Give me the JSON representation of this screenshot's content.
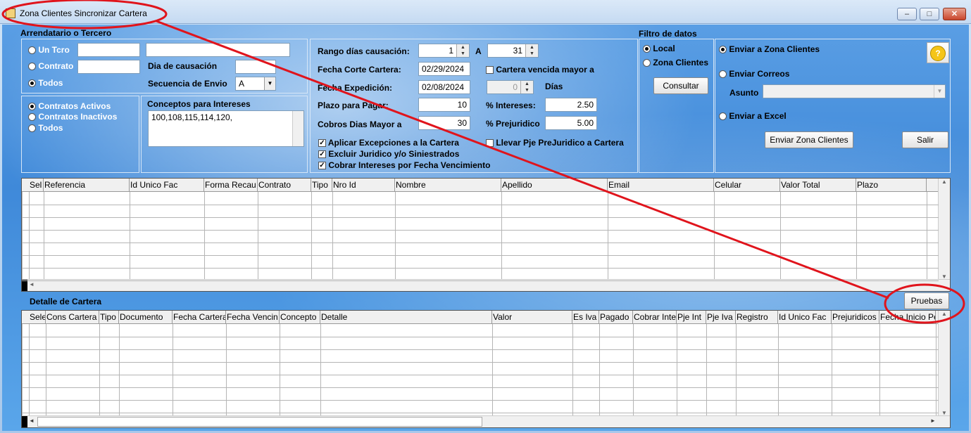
{
  "window": {
    "title": "Zona Clientes Sincronizar Cartera",
    "min": "–",
    "max": "□",
    "close": "✕"
  },
  "tercero": {
    "legend": "Arrendatario o Tercero",
    "opt_tcro": "Un Tcro",
    "opt_contrato": "Contrato",
    "opt_todos": "Todos",
    "dia_causacion_label": "Dia de causación",
    "secuencia_label": "Secuencia de Envio",
    "secuencia_value": "A"
  },
  "contratos": {
    "activos": "Contratos Activos",
    "inactivos": "Contratos Inactivos",
    "todos": "Todos"
  },
  "conceptos": {
    "label": "Conceptos para Intereses",
    "value": "100,108,115,114,120,"
  },
  "params": {
    "rango_label": "Rango días causación:",
    "rango_from": "1",
    "rango_sep": "A",
    "rango_to": "31",
    "fecha_corte_label": "Fecha Corte Cartera:",
    "fecha_corte": "02/29/2024",
    "fecha_exp_label": "Fecha Expedición:",
    "fecha_exp": "02/08/2024",
    "plazo_label": "Plazo para Pagar:",
    "plazo": "10",
    "cobros_label": "Cobros Dias Mayor a",
    "cobros": "30",
    "vencida_label": "Cartera vencida mayor a",
    "dias_value": "0",
    "dias_label": "Días",
    "intereses_label": "% Intereses:",
    "intereses": "2.50",
    "prejur_label": "% Prejuridico",
    "prejur": "5.00",
    "chk_excepciones": "Aplicar Excepciones a la Cartera",
    "chk_excluir": "Excluir Juridico y/o Siniestrados",
    "chk_cobrar": "Cobrar Intereses por Fecha Vencimiento",
    "chk_llevar": "Llevar Pje PreJuridico a Cartera"
  },
  "filtro": {
    "title": "Filtro de datos",
    "local": "Local",
    "zona": "Zona Clientes",
    "consultar": "Consultar"
  },
  "envio": {
    "zona": "Enviar a Zona Clientes",
    "correos": "Enviar Correos",
    "asunto": "Asunto",
    "excel": "Enviar a Excel",
    "btn_enviar": "Enviar Zona Clientes",
    "btn_salir": "Salir",
    "help": "?"
  },
  "grid1": {
    "columns": [
      "Sel",
      "Referencia",
      "Id Unico Fac",
      "Forma Recau",
      "Contrato",
      "Tipo",
      "Nro Id",
      "Nombre",
      "Apellido",
      "Email",
      "Celular",
      "Valor Total",
      "Plazo"
    ]
  },
  "detalle": {
    "title": "Detalle de Cartera",
    "pruebas": "Pruebas",
    "columns": [
      "Sele",
      "Cons Cartera",
      "Tipo",
      "Documento",
      "Fecha Cartera",
      "Fecha Vencin",
      "Concepto",
      "Detalle",
      "Valor",
      "Es Iva",
      "Pagado",
      "Cobrar Inte",
      "Pje Int",
      "Pje Iva",
      "Registro",
      "Id Unico Fac",
      "Prejuridicos",
      "Fecha Inicio Pe"
    ]
  },
  "scroll": {
    "up": "▲",
    "down": "▼",
    "left": "◄",
    "right": "►"
  }
}
